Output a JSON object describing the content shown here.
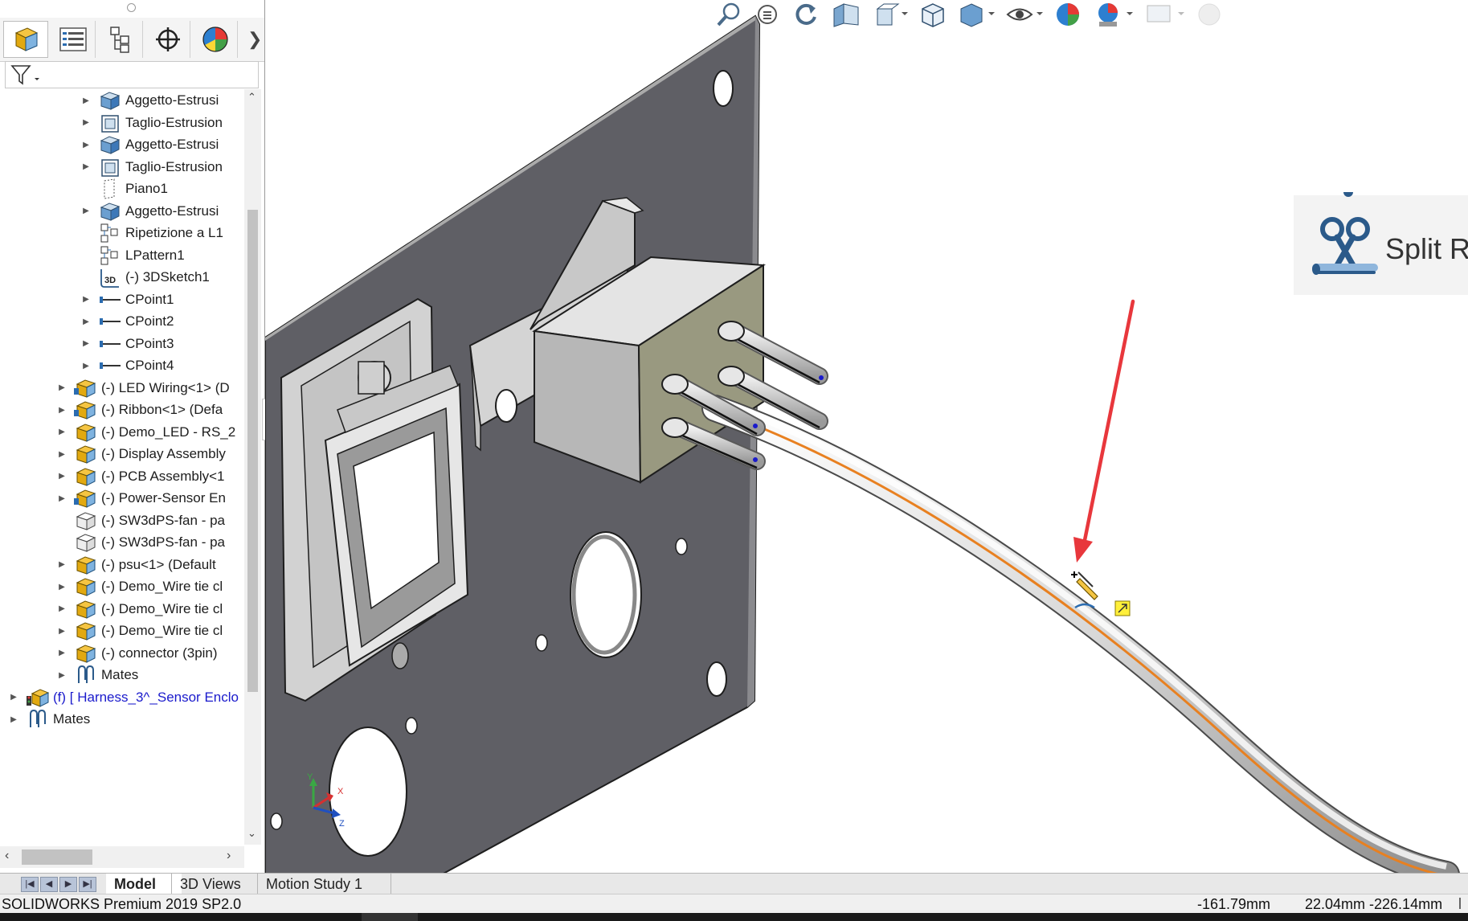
{
  "app": {
    "name": "SOLIDWORKS Premium 2019 SP2.0"
  },
  "panel_tabs": [
    {
      "name": "feature-manager-tab",
      "active": true
    },
    {
      "name": "property-manager-tab"
    },
    {
      "name": "configuration-manager-tab"
    },
    {
      "name": "dimxpert-manager-tab"
    },
    {
      "name": "display-manager-tab"
    }
  ],
  "tree": {
    "items": [
      {
        "label": "Aggetto-Estrusi",
        "indent": 1,
        "icon": "extrude-boss-icon",
        "arrow": true
      },
      {
        "label": "Taglio-Estrusion",
        "indent": 1,
        "icon": "extrude-cut-icon",
        "arrow": true
      },
      {
        "label": "Aggetto-Estrusi",
        "indent": 1,
        "icon": "extrude-boss-icon",
        "arrow": true
      },
      {
        "label": "Taglio-Estrusion",
        "indent": 1,
        "icon": "extrude-cut-icon",
        "arrow": true
      },
      {
        "label": "Piano1",
        "indent": 1,
        "icon": "plane-icon",
        "arrow": false
      },
      {
        "label": "Aggetto-Estrusi",
        "indent": 1,
        "icon": "extrude-boss-icon",
        "arrow": true
      },
      {
        "label": "Ripetizione a L1",
        "indent": 1,
        "icon": "linear-pattern-icon",
        "arrow": false
      },
      {
        "label": "LPattern1",
        "indent": 1,
        "icon": "linear-pattern-icon",
        "arrow": false
      },
      {
        "label": "(-) 3DSketch1",
        "indent": 1,
        "icon": "3d-sketch-icon",
        "arrow": false
      },
      {
        "label": "CPoint1",
        "indent": 1,
        "icon": "connection-point-icon",
        "arrow": true
      },
      {
        "label": "CPoint2",
        "indent": 1,
        "icon": "connection-point-icon",
        "arrow": true
      },
      {
        "label": "CPoint3",
        "indent": 1,
        "icon": "connection-point-icon",
        "arrow": true
      },
      {
        "label": "CPoint4",
        "indent": 1,
        "icon": "connection-point-icon",
        "arrow": true
      },
      {
        "label": "(-) LED Wiring<1> (D",
        "indent": 0,
        "icon": "subassembly-icon",
        "arrow": true
      },
      {
        "label": "(-) Ribbon<1> (Defa",
        "indent": 0,
        "icon": "subassembly-icon",
        "arrow": true
      },
      {
        "label": "(-) Demo_LED - RS_2",
        "indent": 0,
        "icon": "assembly-icon",
        "arrow": true
      },
      {
        "label": "(-) Display Assembly",
        "indent": 0,
        "icon": "assembly-icon",
        "arrow": true
      },
      {
        "label": "(-) PCB Assembly<1",
        "indent": 0,
        "icon": "assembly-icon",
        "arrow": true
      },
      {
        "label": "(-) Power-Sensor En",
        "indent": 0,
        "icon": "subassembly-icon",
        "arrow": true
      },
      {
        "label": "(-) SW3dPS-fan - pa",
        "indent": 0,
        "icon": "part-icon",
        "arrow": false
      },
      {
        "label": "(-) SW3dPS-fan - pa",
        "indent": 0,
        "icon": "part-icon",
        "arrow": false
      },
      {
        "label": "(-) psu<1> (Default",
        "indent": 0,
        "icon": "assembly-icon",
        "arrow": true
      },
      {
        "label": "(-) Demo_Wire tie cl",
        "indent": 0,
        "icon": "assembly-icon",
        "arrow": true
      },
      {
        "label": "(-) Demo_Wire tie cl",
        "indent": 0,
        "icon": "assembly-icon",
        "arrow": true
      },
      {
        "label": "(-) Demo_Wire tie cl",
        "indent": 0,
        "icon": "assembly-icon",
        "arrow": true
      },
      {
        "label": "(-) connector (3pin)",
        "indent": 0,
        "icon": "assembly-icon",
        "arrow": true
      },
      {
        "label": "Mates",
        "indent": 0,
        "icon": "mates-icon",
        "arrow": true
      },
      {
        "label": "(f) [ Harness_3^_Sensor Enclo",
        "indent": -1,
        "icon": "harness-assembly-icon",
        "arrow": true,
        "highlight": true
      },
      {
        "label": "Mates",
        "indent": -1,
        "icon": "mates-icon",
        "arrow": true
      }
    ]
  },
  "callout": {
    "label": "Split Route",
    "icon": "scissors-icon"
  },
  "bottom_tabs": [
    {
      "label": "Model",
      "active": true
    },
    {
      "label": "3D Views"
    },
    {
      "label": "Motion Study 1"
    }
  ],
  "status": {
    "product": "SOLIDWORKS Premium 2019 SP2.0",
    "coord1": "-161.79mm",
    "coord2": "22.04mm -226.14mm"
  },
  "colors": {
    "plate": "#6c6c72",
    "connector_body": "#999980",
    "wire_orange": "#e88020",
    "arrow_red": "#e8373c",
    "highlight_text": "#1a1acc"
  }
}
